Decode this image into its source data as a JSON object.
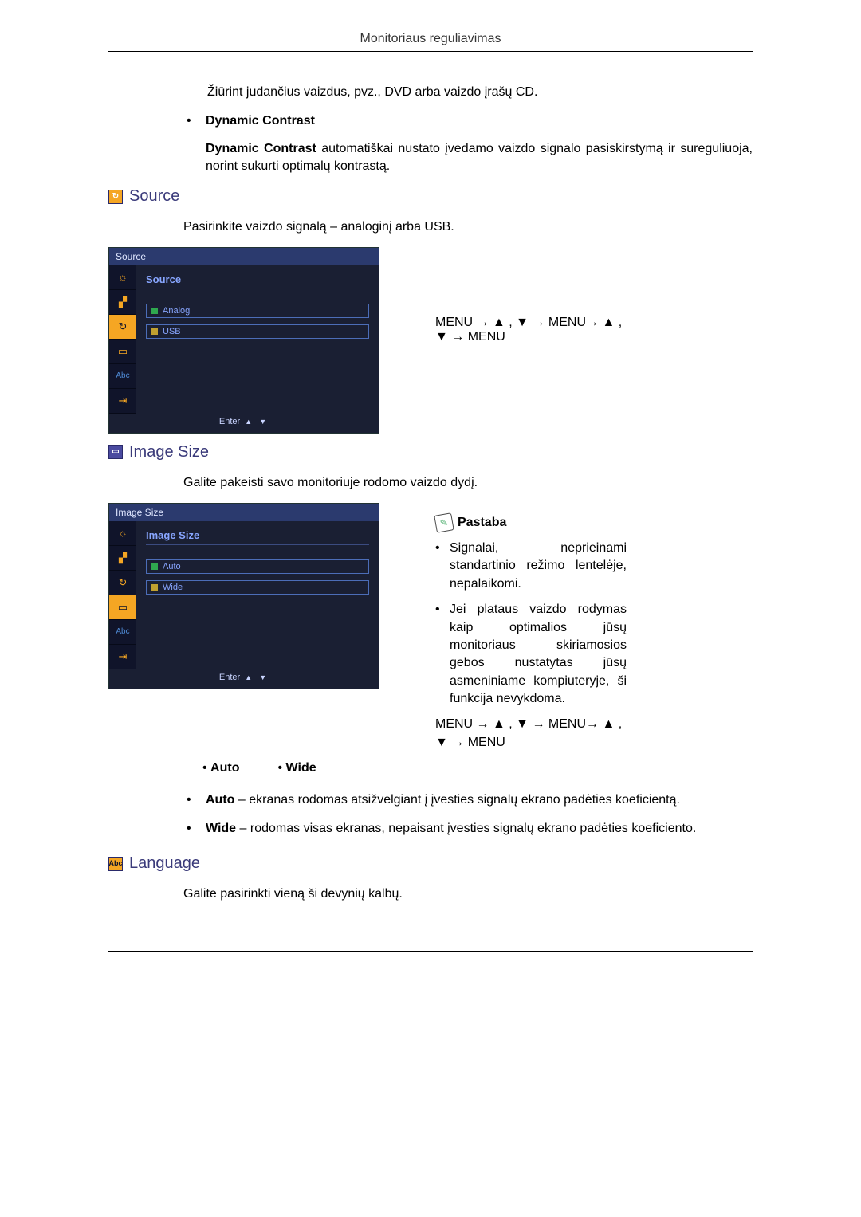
{
  "header": {
    "title": "Monitoriaus reguliavimas"
  },
  "intro": {
    "movie_desc": "Žiūrint judančius vaizdus, pvz., DVD arba vaizdo įrašų CD.",
    "dc_title": "Dynamic Contrast",
    "dc_body": "Dynamic Contrast automatiškai nustato įvedamo vaizdo signalo pasiskirstymą ir sureguliuoja, norint sukurti optimalų kontrastą.",
    "dc_bold_lead": "Dynamic Contrast"
  },
  "source": {
    "heading": "Source",
    "desc": "Pasirinkite vaizdo signalą – analoginį arba USB.",
    "osd": {
      "title": "Source",
      "pane_title": "Source",
      "opt1": "Analog",
      "opt2": "USB",
      "footer_enter": "Enter"
    },
    "menu_seq1": "MENU → ▲ , ▼ → MENU→ ▲ ,",
    "menu_seq2": "▼ → MENU"
  },
  "image_size": {
    "heading": "Image Size",
    "desc": "Galite pakeisti savo monitoriuje rodomo vaizdo dydį.",
    "osd": {
      "title": "Image Size",
      "pane_title": "Image Size",
      "opt1": "Auto",
      "opt2": "Wide",
      "footer_enter": "Enter"
    },
    "note_title": "Pastaba",
    "note_items": [
      "Signalai, neprieinami standartinio režimo lentelėje, nepalaikomi.",
      "Jei plataus vaizdo rodymas kaip optimalios jūsų monitoriaus skiriamosios gebos nustatytas jūsų asmeniniame kompiuteryje, ši funkcija nevykdoma."
    ],
    "menu_seq1": "MENU → ▲ , ▼ → MENU→ ▲ ,",
    "menu_seq2": "▼ → MENU",
    "opts": {
      "auto": "Auto",
      "wide": "Wide"
    },
    "opt_desc": {
      "auto_b": "Auto",
      "auto_t": " – ekranas rodomas atsižvelgiant į įvesties signalų ekrano padėties koeficientą.",
      "wide_b": "Wide",
      "wide_t": " – rodomas visas ekranas, nepaisant įvesties signalų ekrano padėties koeficiento."
    }
  },
  "language": {
    "heading": "Language",
    "desc": "Galite pasirinkti vieną ši devynių kalbų."
  },
  "osd_icons": {
    "i1": "☼",
    "i2": "▞",
    "i3": "↻",
    "i4": "▭",
    "i5": "Abc",
    "i6": "⇥"
  }
}
